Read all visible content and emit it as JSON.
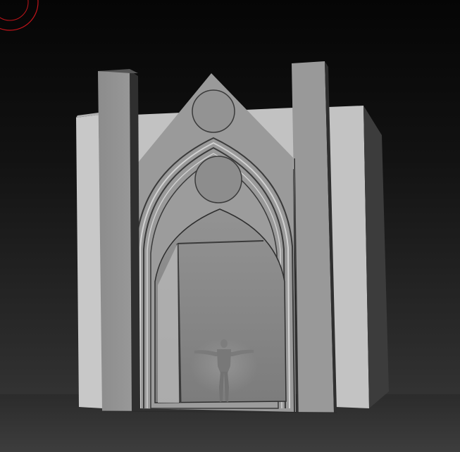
{
  "viewport": {
    "background_top": "#050505",
    "background_bottom": "#3b3b3b"
  },
  "scene": {
    "model": "gothic-portal",
    "figure": "t-pose-human-scale-reference",
    "gizmo_color": "#c0141a",
    "stone_light": "#c4c4c4",
    "stone_mid": "#8e8e8e",
    "stone_dark": "#4a4a4a"
  }
}
